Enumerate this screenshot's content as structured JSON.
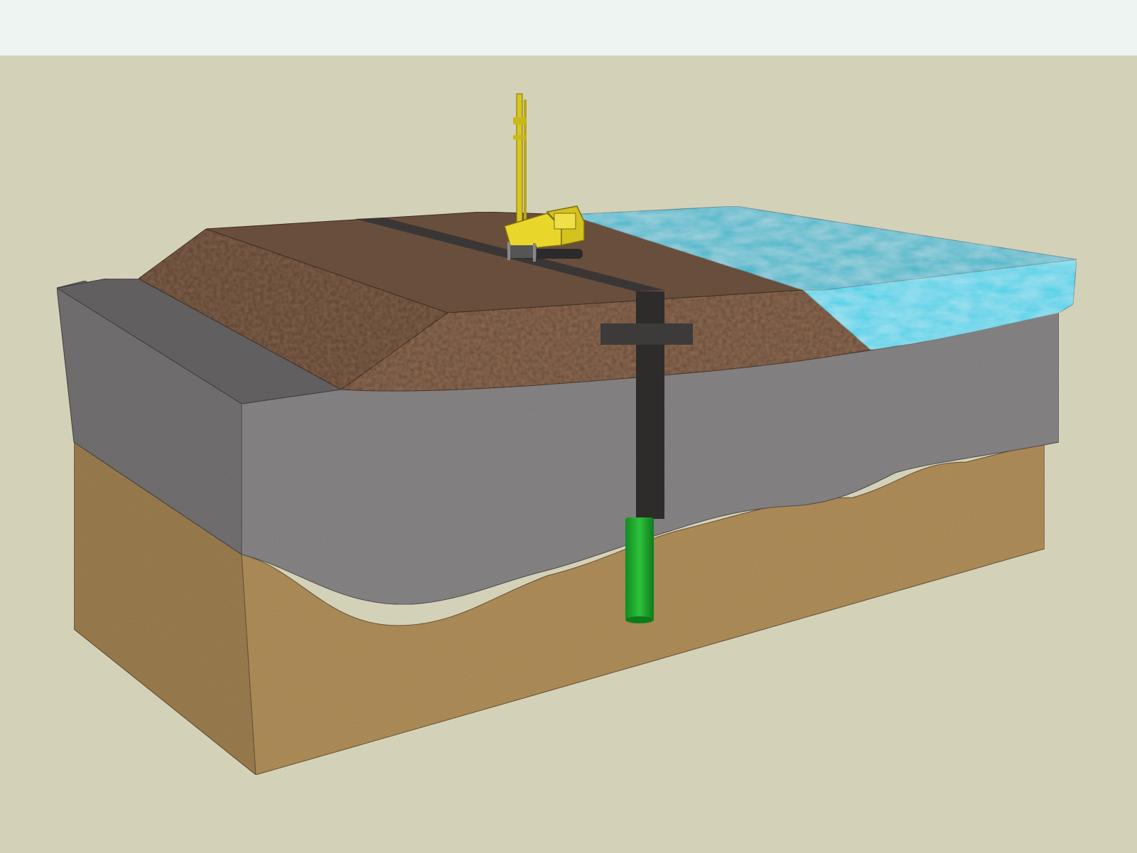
{
  "scene": {
    "description_free": true,
    "layers": [
      {
        "name": "embankment-fill",
        "color": "#8f6b52"
      },
      {
        "name": "soft-clay",
        "color": "#8e8b8c"
      },
      {
        "name": "sand",
        "color": "#b8955e"
      },
      {
        "name": "water",
        "color": "#2fb4c8"
      }
    ],
    "equipment": {
      "name": "drilling-rig",
      "color": "#e8d62a"
    },
    "pile": {
      "cased_color": "#2e2b2b",
      "uncased_color": "#1f9a2e"
    },
    "sky_color": "#eef4f2",
    "background_color": "#d4d1b9"
  }
}
